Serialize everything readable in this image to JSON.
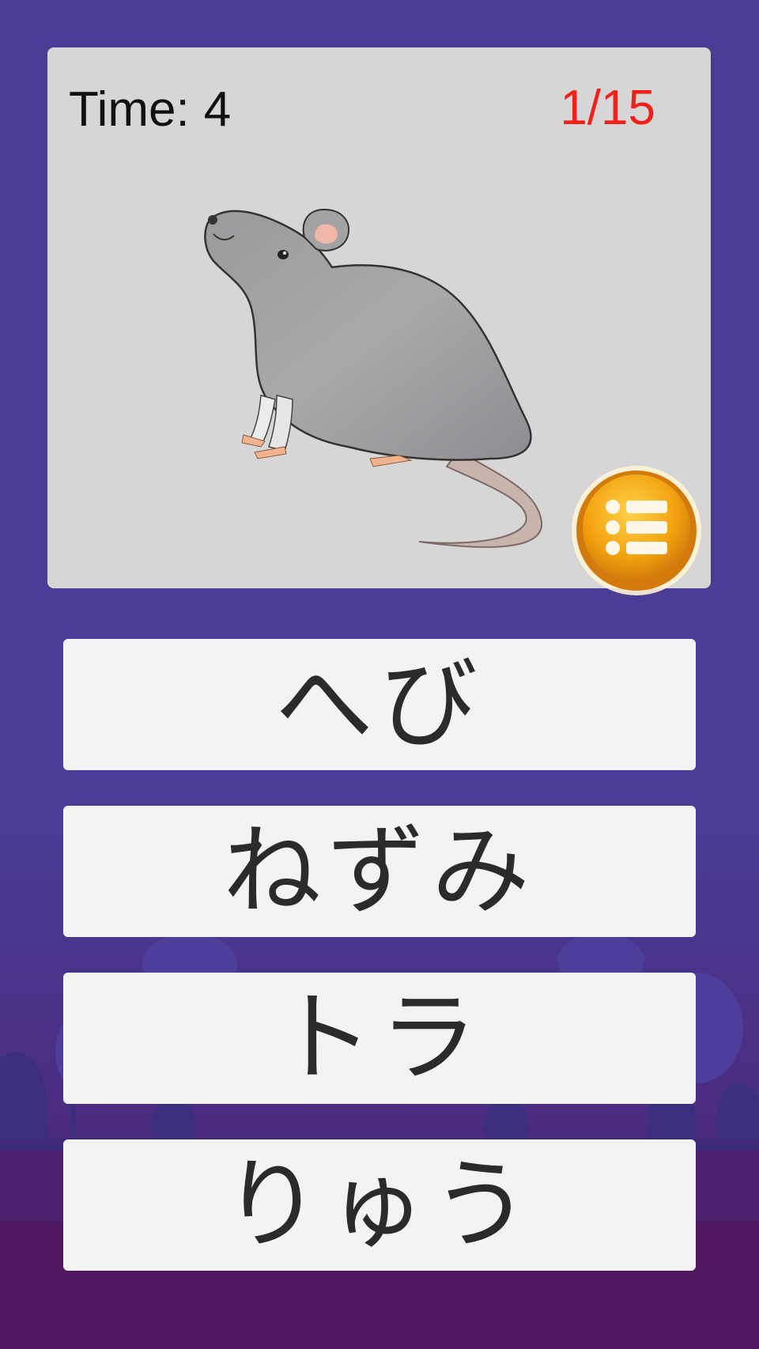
{
  "hud": {
    "time_label": "Time:",
    "time_value": "4",
    "progress": "1/15"
  },
  "question": {
    "image_icon": "rat-illustration"
  },
  "menu_button": {
    "icon": "list-menu-icon",
    "color": "#f2a20f"
  },
  "answers": [
    {
      "label": "へび"
    },
    {
      "label": "ねずみ"
    },
    {
      "label": "トラ"
    },
    {
      "label": "りゅう"
    }
  ],
  "colors": {
    "background": "#4a3c95",
    "card": "#d6d6d6",
    "progress_text": "#f0201a",
    "answer_bg": "#f3f3f4"
  }
}
